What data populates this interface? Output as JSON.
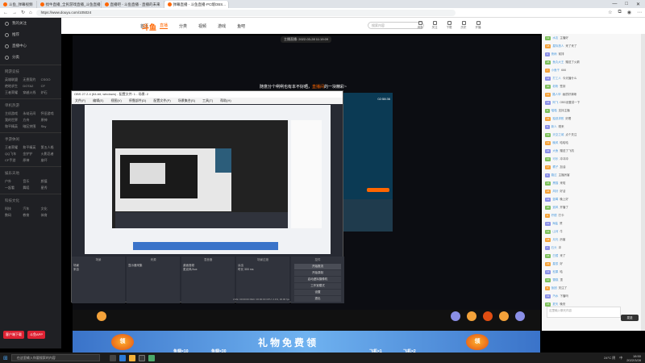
{
  "browser": {
    "tabs": [
      {
        "label": "斗鱼_弹幕视频"
      },
      {
        "label": "找牛直播_全民游戏直播_斗鱼直播"
      },
      {
        "label": "直播吧 - 斗鱼直播 - 直播的未来"
      },
      {
        "label": "弹幕直播 - 斗鱼直播·PC端OBS..."
      }
    ],
    "url": "https://www.douyu.com/105024",
    "window_controls": [
      "—",
      "□",
      "✕"
    ]
  },
  "sidebar": {
    "items": [
      {
        "label": "我的关注"
      },
      {
        "label": "推荐"
      },
      {
        "label": "直播中心"
      },
      {
        "label": "分类"
      }
    ],
    "sections": [
      {
        "title": "网游竞技",
        "tags": [
          "英雄联盟",
          "无畏契约",
          "CSGO",
          "绝地求生",
          "DOTA2",
          "CF",
          "王者荣耀",
          "穿越火线",
          "炉石"
        ]
      },
      {
        "title": "单机热游",
        "tags": [
          "主机游戏",
          "永劫无间",
          "怀旧游戏",
          "我的世界",
          "方舟",
          "原神",
          "和平精英",
          "暗区突围",
          "Sky"
        ]
      },
      {
        "title": "手游休闲",
        "tags": [
          "王者荣耀",
          "和平精英",
          "第五人格",
          "QQ飞车",
          "金铲铲",
          "火影忍者",
          "CF手游",
          "原神",
          "崩坏"
        ]
      },
      {
        "title": "娱乐天地",
        "tags": [
          "户外",
          "音乐",
          "颜值",
          "一起看",
          "舞蹈",
          "星秀"
        ]
      },
      {
        "title": "科技文化",
        "tags": [
          "科技",
          "汽车",
          "文化",
          "数码",
          "教育",
          "体育"
        ]
      }
    ],
    "bottom_buttons": [
      "客户端下载",
      "斗鱼APP"
    ]
  },
  "header": {
    "logo": "斗鱼",
    "nav": [
      "首页",
      "直播",
      "分类",
      "视频",
      "游戏",
      "鱼吧"
    ],
    "active_nav": "直播",
    "search_placeholder": "搜索内容",
    "icons": [
      "消息",
      "关注",
      "下载",
      "历史",
      "开播"
    ]
  },
  "player": {
    "live_time": "主播直播: 2022-03-28 11:19:09",
    "banner": "随意分个咧咧也有本不好晒，直播间的一块精彩~",
    "banner_highlight": "直播间",
    "obs": {
      "title": "OBS 27.2.4 (64-bit, windows) - 配置文件: 1 - 场景: 2",
      "menu": [
        "文件(F)",
        "编辑(E)",
        "视图(V)",
        "停靠部件(D)",
        "配置文件(P)",
        "场景集合(S)",
        "工具(T)",
        "帮助(H)"
      ],
      "panels": [
        {
          "title": "场景",
          "items": [
            "场景",
            "来自"
          ]
        },
        {
          "title": "来源",
          "items": [
            "显示器采集"
          ]
        },
        {
          "title": "混音器",
          "items": [
            "桌面音频",
            "麦克风/Aux"
          ]
        },
        {
          "title": "场景过渡",
          "items": [
            "淡出",
            "时长 300 ms"
          ]
        },
        {
          "title": "控件",
          "items": [
            "开始推流",
            "开始录制",
            "启动虚拟摄像机",
            "工作室模式",
            "设置",
            "退出"
          ]
        }
      ],
      "status": "LIVE: 00:00:00   REC: 00:00:00   CPU: 2.1%, 30.00 fps"
    },
    "right_card_time": "02:58:36"
  },
  "chat": {
    "messages": [
      {
        "level": "12",
        "name": "水友",
        "text": "主播好"
      },
      {
        "level": "18",
        "name": "星际旅人",
        "text": "来了来了"
      },
      {
        "level": "9",
        "name": "夜雨",
        "text": "前排"
      },
      {
        "level": "25",
        "name": "鱼丸大王",
        "text": "赠送了火箭"
      },
      {
        "level": "7",
        "name": "小鱼干",
        "text": "666"
      },
      {
        "level": "14",
        "name": "打工人",
        "text": "今天播什么"
      },
      {
        "level": "30",
        "name": "老粉",
        "text": "签到"
      },
      {
        "level": "11",
        "name": "路人甲",
        "text": "画质好清晰"
      },
      {
        "level": "16",
        "name": "阿飞",
        "text": "OBS设置讲一下"
      },
      {
        "level": "8",
        "name": "喵喵",
        "text": "支持主播"
      },
      {
        "level": "21",
        "name": "独孤求败",
        "text": "好看"
      },
      {
        "level": "5",
        "name": "新人",
        "text": "刚来"
      },
      {
        "level": "19",
        "name": "天空之城",
        "text": "点个关注"
      },
      {
        "level": "13",
        "name": "晚风",
        "text": "哈哈哈"
      },
      {
        "level": "22",
        "name": "大鱼",
        "text": "赠送了飞机"
      },
      {
        "level": "10",
        "name": "可乐",
        "text": "冲冲冲"
      },
      {
        "level": "17",
        "name": "橘子",
        "text": "加油"
      },
      {
        "level": "6",
        "name": "路过",
        "text": "主播厉害"
      },
      {
        "level": "15",
        "name": "黑猫",
        "text": "来啦"
      },
      {
        "level": "24",
        "name": "风铃",
        "text": "好活"
      },
      {
        "level": "12",
        "name": "蓝莓",
        "text": "晚上好"
      },
      {
        "level": "20",
        "name": "追风",
        "text": "开播了"
      },
      {
        "level": "9",
        "name": "柠檬",
        "text": "打卡"
      },
      {
        "level": "11",
        "name": "海盐",
        "text": "赞"
      },
      {
        "level": "14",
        "name": "山河",
        "text": "牛"
      },
      {
        "level": "18",
        "name": "月光",
        "text": "厉害"
      },
      {
        "level": "7",
        "name": "石头",
        "text": "冲"
      },
      {
        "level": "16",
        "name": "白鹭",
        "text": "来了"
      },
      {
        "level": "21",
        "name": "星辰",
        "text": "好"
      },
      {
        "level": "13",
        "name": "松果",
        "text": "哈"
      },
      {
        "level": "10",
        "name": "雪糕",
        "text": "顶"
      },
      {
        "level": "8",
        "name": "饭团",
        "text": "关注了"
      },
      {
        "level": "19",
        "name": "汽水",
        "text": "下播吗"
      },
      {
        "level": "15",
        "name": "夏天",
        "text": "晚安"
      }
    ],
    "input_placeholder": "这里输入聊天内容",
    "send_label": "发送"
  },
  "gift_banner": {
    "main": "礼物免费领",
    "ling": "领",
    "sub_left": [
      "鱼翅×10",
      "鱼翅×30"
    ],
    "sub_right": [
      "飞机×1",
      "飞机×2"
    ]
  },
  "taskbar": {
    "search": "在这里输入你要搜索的内容",
    "weather": "24°C 阴",
    "time": "18:50",
    "date": "2022/3/28",
    "lang": "中"
  },
  "colors": {
    "accent": "#ff6600",
    "obs_bg": "#272a33",
    "sidebar_bg": "#1f2024"
  }
}
